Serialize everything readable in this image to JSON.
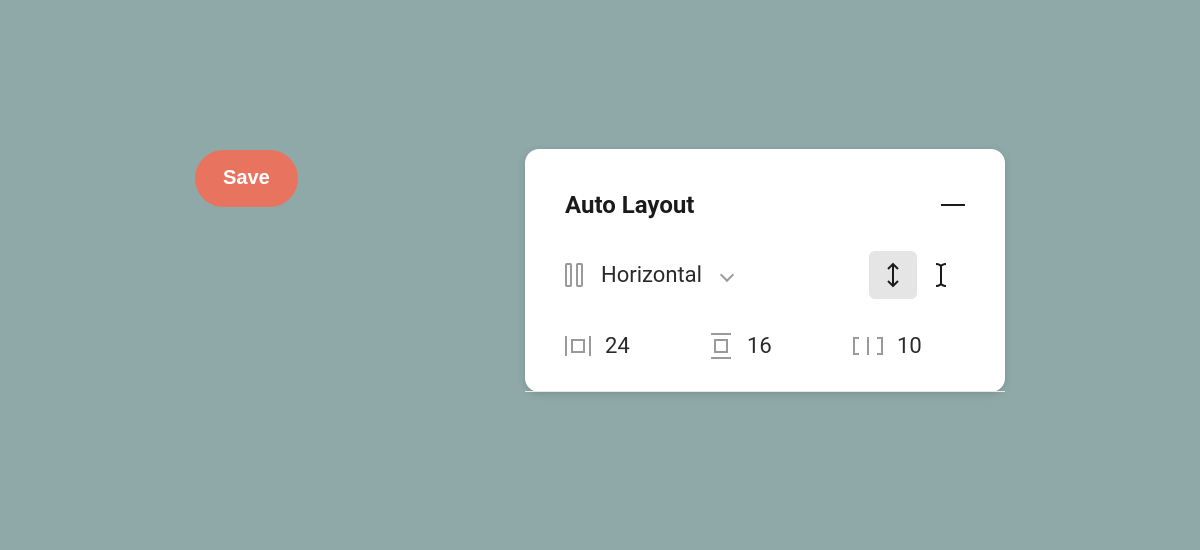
{
  "save_button": {
    "label": "Save"
  },
  "panel": {
    "title": "Auto Layout",
    "direction": {
      "label": "Horizontal"
    },
    "fields": {
      "padding_horizontal": "24",
      "padding_vertical": "16",
      "spacing": "10"
    }
  }
}
